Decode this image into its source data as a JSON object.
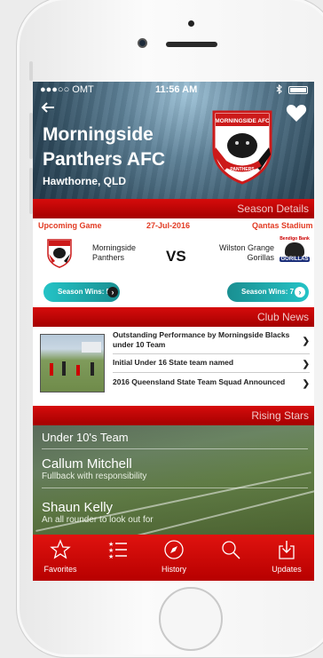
{
  "status_bar": {
    "carrier": "●●●○○ OMT",
    "time": "11:56 AM"
  },
  "club": {
    "name_line1": "Morningside",
    "name_line2": "Panthers AFC",
    "location": "Hawthorne, QLD",
    "logo_top_text": "MORNINGSIDE AFC",
    "logo_bottom_text": "PANTHERS"
  },
  "sections": {
    "season_details": "Season Details",
    "club_news": "Club News",
    "rising_stars": "Rising Stars"
  },
  "upcoming": {
    "label": "Upcoming Game",
    "date": "27-Jul-2016",
    "venue": "Qantas Stadium"
  },
  "match": {
    "home_line1": "Morningside",
    "home_line2": "Panthers",
    "vs": "VS",
    "away_line1": "Wilston Grange",
    "away_line2": "Gorillas",
    "away_badge_top": "Bendigo Bank",
    "away_badge": "GORILLAS",
    "home_wins": "Season Wins: 5",
    "away_wins": "Season Wins: 7"
  },
  "news": [
    {
      "title": "Outstanding Performance by Morningside Blacks under 10 Team"
    },
    {
      "title": "Initial Under 16 State team named"
    },
    {
      "title": "2016 Queensland State Team Squad Announced"
    }
  ],
  "rising": {
    "team": "Under 10's Team",
    "players": [
      {
        "name": "Callum Mitchell",
        "desc": "Fullback with responsibility"
      },
      {
        "name": "Shaun Kelly",
        "desc": "An all rounder to look out for"
      }
    ]
  },
  "tabs": [
    {
      "label": "Favorites",
      "icon": "star-icon"
    },
    {
      "label": "",
      "icon": "list-icon"
    },
    {
      "label": "History",
      "icon": "compass-icon"
    },
    {
      "label": "",
      "icon": "search-icon"
    },
    {
      "label": "Updates",
      "icon": "download-icon"
    }
  ],
  "colors": {
    "primary_red": "#d60c0c",
    "accent_teal": "#1fb5b8"
  }
}
